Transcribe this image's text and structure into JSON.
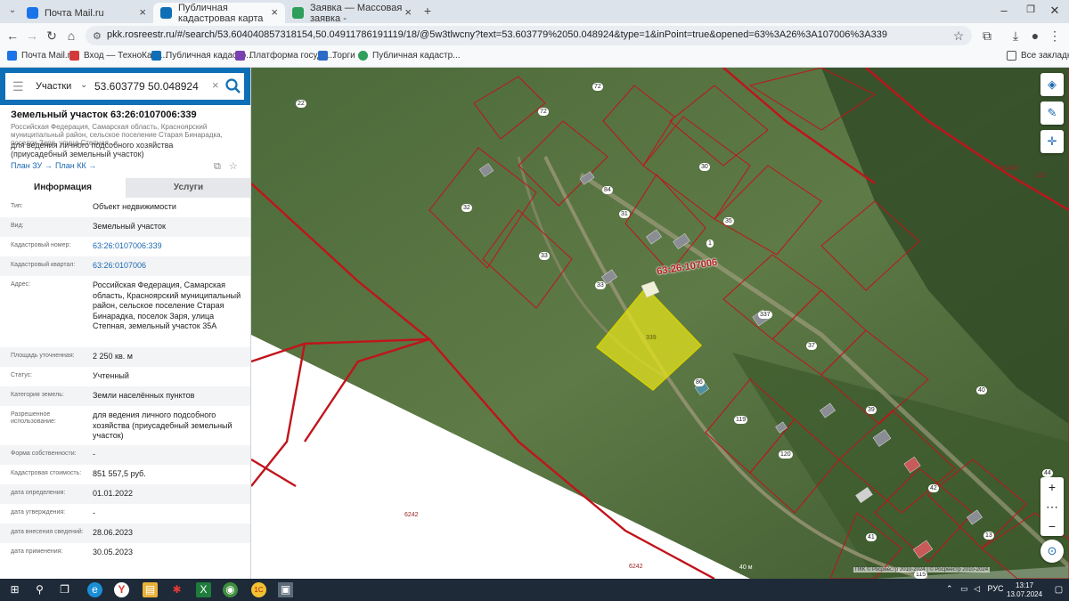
{
  "browser": {
    "tabs": [
      {
        "title": "Почта Mail.ru",
        "active": false,
        "color": "#1a73e8"
      },
      {
        "title": "Публичная кадастровая карта",
        "active": true,
        "color": "#0f6fb6"
      },
      {
        "title": "Заявка — Массовая заявка -",
        "active": false,
        "color": "#2e9e5b"
      }
    ],
    "url": "pkk.rosreestr.ru/#/search/53.604040857318154,50.04911786191119/18/@5w3tlwcny?text=53.603779%2050.048924&type=1&inPoint=true&opened=63%3A26%3A107006%3A339",
    "bookmarks": [
      "Почта Mail.ru",
      "Вход — ТехноКад-...",
      "Публичная кадастр...",
      "Платформа госуда...",
      "Торги",
      "Публичная кадастр..."
    ],
    "all_bookmarks": "Все закладки"
  },
  "search": {
    "mode": "Участки",
    "query": "53.603779 50.048924"
  },
  "object": {
    "title": "Земельный участок 63:26:0107006:339",
    "address_short": "Российская Федерация, Самарская область, Красноярский муниципальный район, сельское поселение Старая Бинарадка, поселок Заря, улица Степная,...",
    "purpose": "для ведения личного подсобного хозяйства (приусадебный земельный участок)",
    "plan_zu": "План ЗУ →",
    "plan_kk": "План КК →"
  },
  "tabs": {
    "info": "Информация",
    "services": "Услуги"
  },
  "properties": [
    {
      "key": "Тип:",
      "value": "Объект недвижимости",
      "link": false
    },
    {
      "key": "Вид:",
      "value": "Земельный участок",
      "link": false
    },
    {
      "key": "Кадастровый номер:",
      "value": "63:26:0107006:339",
      "link": true
    },
    {
      "key": "Кадастровый квартал:",
      "value": "63:26:0107006",
      "link": true
    },
    {
      "key": "Адрес:",
      "value": "Российская Федерация, Самарская область, Красноярский муниципальный район, сельское поселение Старая Бинарадка, поселок Заря, улица Степная, земельный участок 35А",
      "link": false
    },
    {
      "key": "Площадь уточненная:",
      "value": "2 250 кв. м",
      "link": false
    },
    {
      "key": "Статус:",
      "value": "Учтенный",
      "link": false
    },
    {
      "key": "Категория земель:",
      "value": "Земли населённых пунктов",
      "link": false
    },
    {
      "key": "Разрешенное использование:",
      "value": "для ведения личного подсобного хозяйства (приусадебный земельный участок)",
      "link": false
    },
    {
      "key": "Форма собственности:",
      "value": "-",
      "link": false
    },
    {
      "key": "Кадастровая стоимость:",
      "value": "851 557,5 руб.",
      "link": false
    },
    {
      "key": "дата определения:",
      "value": "01.01.2022",
      "link": false
    },
    {
      "key": "дата утверждения:",
      "value": "-",
      "link": false
    },
    {
      "key": "дата внесения сведений:",
      "value": "28.06.2023",
      "link": false
    },
    {
      "key": "дата применения:",
      "value": "30.05.2023",
      "link": false
    }
  ],
  "map": {
    "quarter_label": "63:26:107006",
    "selected_parcel": "339",
    "selected_color": "#e8e61a",
    "boundary_color": "#c0141b",
    "parcel_labels": [
      "72",
      "72",
      "30",
      "84",
      "31",
      "32",
      "33",
      "33",
      "35",
      "1",
      "337",
      "37",
      "86",
      "119",
      "120",
      "39",
      "40",
      "42",
      "41",
      "44",
      "13",
      "115",
      "22",
      "264/20",
      "132",
      "6242",
      "6242"
    ],
    "scale": "40 м",
    "copyright": "ПКК © Росреестр 2010-2024 | © Росреестр 2010-2024"
  },
  "taskbar": {
    "language": "РУС",
    "time": "13:17",
    "date": "13.07.2024"
  }
}
